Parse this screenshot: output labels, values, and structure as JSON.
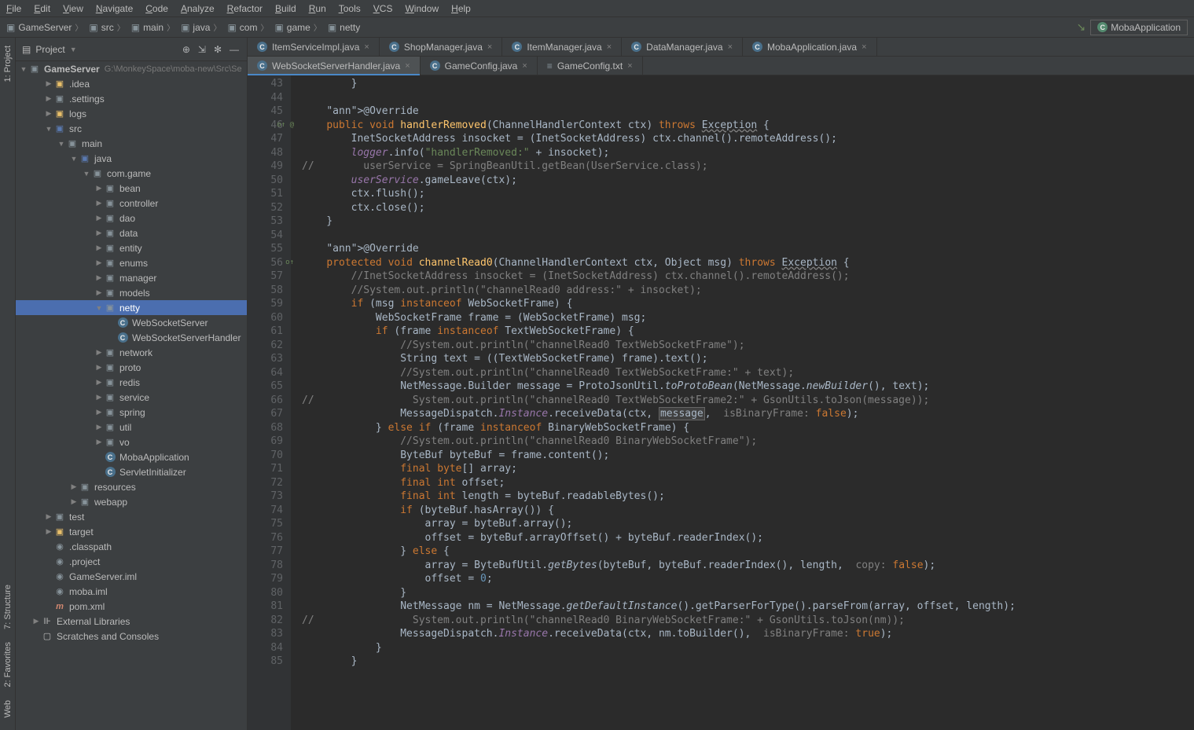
{
  "menu": [
    "File",
    "Edit",
    "View",
    "Navigate",
    "Code",
    "Analyze",
    "Refactor",
    "Build",
    "Run",
    "Tools",
    "VCS",
    "Window",
    "Help"
  ],
  "breadcrumbs": [
    "GameServer",
    "src",
    "main",
    "java",
    "com",
    "game",
    "netty"
  ],
  "runConfig": "MobaApplication",
  "sideTabs": {
    "project": "1: Project",
    "structure": "7: Structure",
    "favorites": "2: Favorites",
    "web": "Web"
  },
  "projectPanel": {
    "title": "Project",
    "root": {
      "name": "GameServer",
      "hint": "G:\\MonkeySpace\\moba-new\\Src\\Se"
    },
    "items": [
      {
        "d": 1,
        "arrow": "▶",
        "icon": "folder",
        "label": ".idea",
        "cls": "target-icon"
      },
      {
        "d": 1,
        "arrow": "▶",
        "icon": "folder",
        "label": ".settings"
      },
      {
        "d": 1,
        "arrow": "▶",
        "icon": "folder",
        "label": "logs",
        "cls": "target-icon"
      },
      {
        "d": 1,
        "arrow": "▼",
        "icon": "folder",
        "label": "src",
        "cls": "src-folder-icon"
      },
      {
        "d": 2,
        "arrow": "▼",
        "icon": "folder",
        "label": "main"
      },
      {
        "d": 3,
        "arrow": "▼",
        "icon": "folder",
        "label": "java",
        "cls": "src-folder-icon"
      },
      {
        "d": 4,
        "arrow": "▼",
        "icon": "folder",
        "label": "com.game"
      },
      {
        "d": 5,
        "arrow": "▶",
        "icon": "folder",
        "label": "bean"
      },
      {
        "d": 5,
        "arrow": "▶",
        "icon": "folder",
        "label": "controller"
      },
      {
        "d": 5,
        "arrow": "▶",
        "icon": "folder",
        "label": "dao"
      },
      {
        "d": 5,
        "arrow": "▶",
        "icon": "folder",
        "label": "data"
      },
      {
        "d": 5,
        "arrow": "▶",
        "icon": "folder",
        "label": "entity"
      },
      {
        "d": 5,
        "arrow": "▶",
        "icon": "folder",
        "label": "enums"
      },
      {
        "d": 5,
        "arrow": "▶",
        "icon": "folder",
        "label": "manager"
      },
      {
        "d": 5,
        "arrow": "▶",
        "icon": "folder",
        "label": "models"
      },
      {
        "d": 5,
        "arrow": "▼",
        "icon": "folder",
        "label": "netty",
        "selected": true
      },
      {
        "d": 6,
        "arrow": " ",
        "icon": "class",
        "label": "WebSocketServer"
      },
      {
        "d": 6,
        "arrow": " ",
        "icon": "class",
        "label": "WebSocketServerHandler"
      },
      {
        "d": 5,
        "arrow": "▶",
        "icon": "folder",
        "label": "network"
      },
      {
        "d": 5,
        "arrow": "▶",
        "icon": "folder",
        "label": "proto"
      },
      {
        "d": 5,
        "arrow": "▶",
        "icon": "folder",
        "label": "redis"
      },
      {
        "d": 5,
        "arrow": "▶",
        "icon": "folder",
        "label": "service"
      },
      {
        "d": 5,
        "arrow": "▶",
        "icon": "folder",
        "label": "spring"
      },
      {
        "d": 5,
        "arrow": "▶",
        "icon": "folder",
        "label": "util"
      },
      {
        "d": 5,
        "arrow": "▶",
        "icon": "folder",
        "label": "vo"
      },
      {
        "d": 5,
        "arrow": " ",
        "icon": "class",
        "label": "MobaApplication"
      },
      {
        "d": 5,
        "arrow": " ",
        "icon": "class",
        "label": "ServletInitializer"
      },
      {
        "d": 3,
        "arrow": "▶",
        "icon": "folder",
        "label": "resources"
      },
      {
        "d": 3,
        "arrow": "▶",
        "icon": "folder",
        "label": "webapp"
      },
      {
        "d": 1,
        "arrow": "▶",
        "icon": "folder",
        "label": "test"
      },
      {
        "d": 1,
        "arrow": "▶",
        "icon": "folder",
        "label": "target",
        "cls": "target-icon"
      },
      {
        "d": 1,
        "arrow": " ",
        "icon": "file",
        "label": ".classpath"
      },
      {
        "d": 1,
        "arrow": " ",
        "icon": "file",
        "label": ".project"
      },
      {
        "d": 1,
        "arrow": " ",
        "icon": "file",
        "label": "GameServer.iml"
      },
      {
        "d": 1,
        "arrow": " ",
        "icon": "file",
        "label": "moba.iml"
      },
      {
        "d": 1,
        "arrow": " ",
        "icon": "xml",
        "label": "pom.xml"
      },
      {
        "d": 0,
        "arrow": "▶",
        "icon": "lib",
        "label": "External Libraries"
      },
      {
        "d": 0,
        "arrow": " ",
        "icon": "scratch",
        "label": "Scratches and Consoles"
      }
    ]
  },
  "tabs1": [
    {
      "label": "ItemServiceImpl.java",
      "type": "class"
    },
    {
      "label": "ShopManager.java",
      "type": "class"
    },
    {
      "label": "ItemManager.java",
      "type": "class"
    },
    {
      "label": "DataManager.java",
      "type": "class"
    },
    {
      "label": "MobaApplication.java",
      "type": "class"
    }
  ],
  "tabs2": [
    {
      "label": "WebSocketServerHandler.java",
      "type": "class",
      "active": true
    },
    {
      "label": "GameConfig.java",
      "type": "class"
    },
    {
      "label": "GameConfig.txt",
      "type": "text"
    }
  ],
  "code": {
    "start": 43,
    "lines": [
      "        }",
      "",
      "    @Override",
      "    public void handlerRemoved(ChannelHandlerContext ctx) throws Exception {",
      "        InetSocketAddress insocket = (InetSocketAddress) ctx.channel().remoteAddress();",
      "        logger.info(\"handlerRemoved:\" + insocket);",
      "//        userService = SpringBeanUtil.getBean(UserService.class);",
      "        userService.gameLeave(ctx);",
      "        ctx.flush();",
      "        ctx.close();",
      "    }",
      "",
      "    @Override",
      "    protected void channelRead0(ChannelHandlerContext ctx, Object msg) throws Exception {",
      "        //InetSocketAddress insocket = (InetSocketAddress) ctx.channel().remoteAddress();",
      "        //System.out.println(\"channelRead0 address:\" + insocket);",
      "        if (msg instanceof WebSocketFrame) {",
      "            WebSocketFrame frame = (WebSocketFrame) msg;",
      "            if (frame instanceof TextWebSocketFrame) {",
      "                //System.out.println(\"channelRead0 TextWebSocketFrame\");",
      "                String text = ((TextWebSocketFrame) frame).text();",
      "                //System.out.println(\"channelRead0 TextWebSocketFrame:\" + text);",
      "                NetMessage.Builder message = ProtoJsonUtil.toProtoBean(NetMessage.newBuilder(), text);",
      "//                System.out.println(\"channelRead0 TextWebSocketFrame2:\" + GsonUtils.toJson(message));",
      "                MessageDispatch.Instance.receiveData(ctx, message,  isBinaryFrame: false);",
      "            } else if (frame instanceof BinaryWebSocketFrame) {",
      "                //System.out.println(\"channelRead0 BinaryWebSocketFrame\");",
      "                ByteBuf byteBuf = frame.content();",
      "                final byte[] array;",
      "                final int offset;",
      "                final int length = byteBuf.readableBytes();",
      "                if (byteBuf.hasArray()) {",
      "                    array = byteBuf.array();",
      "                    offset = byteBuf.arrayOffset() + byteBuf.readerIndex();",
      "                } else {",
      "                    array = ByteBufUtil.getBytes(byteBuf, byteBuf.readerIndex(), length,  copy: false);",
      "                    offset = 0;",
      "                }",
      "                NetMessage nm = NetMessage.getDefaultInstance().getParserForType().parseFrom(array, offset, length);",
      "//                System.out.println(\"channelRead0 BinaryWebSocketFrame:\" + GsonUtils.toJson(nm));",
      "                MessageDispatch.Instance.receiveData(ctx, nm.toBuilder(),  isBinaryFrame: true);",
      "            }",
      "        }"
    ]
  }
}
